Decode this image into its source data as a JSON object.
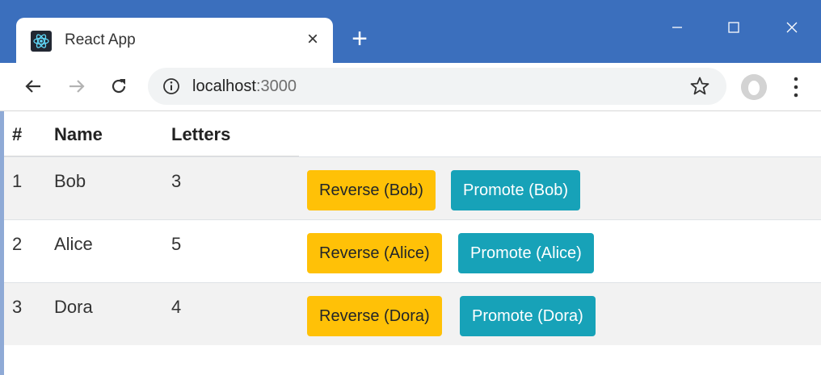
{
  "browser": {
    "tab_title": "React App",
    "tab_close_glyph": "×",
    "new_tab_glyph": "+",
    "url_host": "localhost",
    "url_port": ":3000",
    "icons": [
      "react-favicon-icon",
      "close-icon",
      "plus-icon",
      "minimize-icon",
      "maximize-icon",
      "window-close-icon",
      "back-arrow-icon",
      "forward-arrow-icon",
      "reload-icon",
      "info-icon",
      "star-icon",
      "profile-avatar-icon",
      "more-menu-icon"
    ],
    "colors": {
      "titlebar": "#3b6fbd",
      "omnibox": "#f1f3f4"
    }
  },
  "table": {
    "headers": {
      "index": "#",
      "name": "Name",
      "letters": "Letters"
    },
    "rows": [
      {
        "index": "1",
        "name": "Bob",
        "letters": "3",
        "reverse": "Reverse (Bob)",
        "promote": "Promote (Bob)"
      },
      {
        "index": "2",
        "name": "Alice",
        "letters": "5",
        "reverse": "Reverse (Alice)",
        "promote": "Promote (Alice)"
      },
      {
        "index": "3",
        "name": "Dora",
        "letters": "4",
        "reverse": "Reverse (Dora)",
        "promote": "Promote (Dora)"
      }
    ],
    "colors": {
      "reverse_button": "#ffc107",
      "promote_button": "#17a2b8",
      "striped_row": "#f2f2f2"
    }
  }
}
